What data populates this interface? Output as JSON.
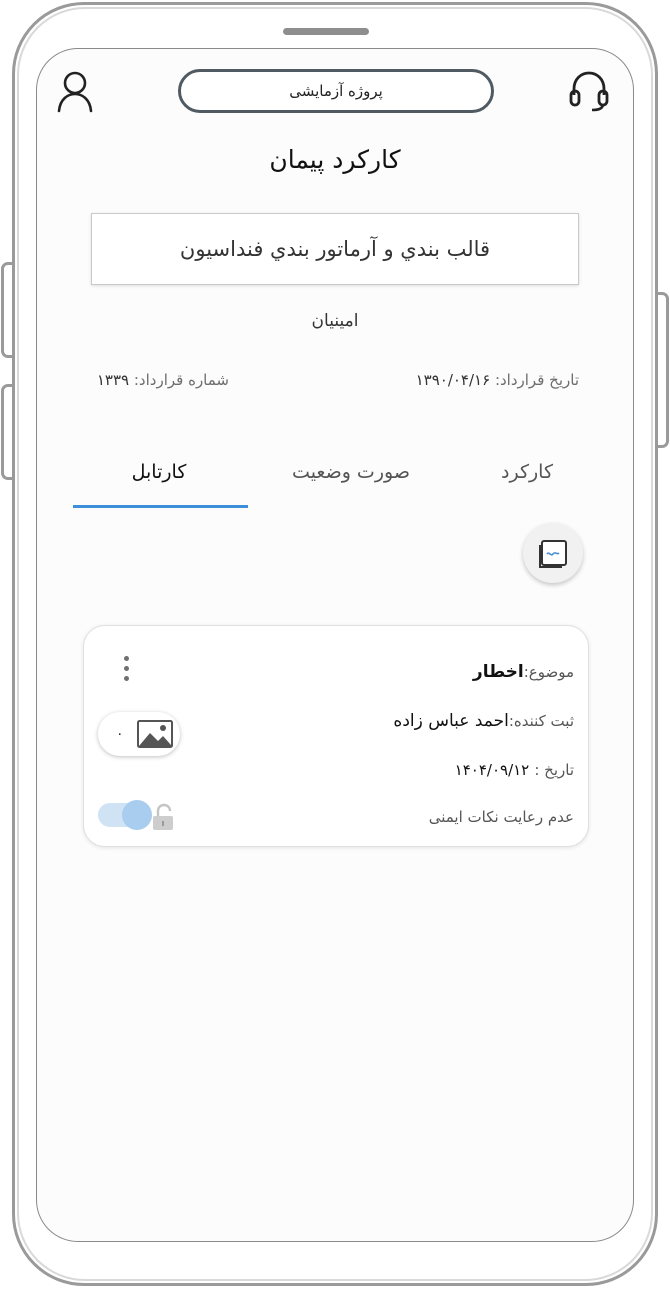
{
  "header": {
    "project_name": "پروژه آزمایشی",
    "profile_icon": "user-icon",
    "support_icon": "headset-icon"
  },
  "page_title": "کارکرد پیمان",
  "contract": {
    "title": "قالب بندي و آرماتور بندي فنداسيون",
    "contractor": "امینیان",
    "date_label": "تاریخ قرارداد:",
    "date_value": "۱۳۹۰/۰۴/۱۶",
    "number_label": "شماره قرارداد:",
    "number_value": "۱۳۳۹"
  },
  "tabs": [
    {
      "label": "کارکرد",
      "active": false
    },
    {
      "label": "صورت وضعیت",
      "active": false
    },
    {
      "label": "کارتابل",
      "active": true
    }
  ],
  "fab_icon": "new-document-icon",
  "cards": [
    {
      "subject_label": "موضوع:",
      "subject_value": "اخطار",
      "creator_label": "ثبت کننده:",
      "creator_value": "احمد عباس زاده",
      "date_label": "تاریخ :",
      "date_value": "۱۴۰۴/۰۹/۱۲",
      "description": "عدم رعایت نکات ایمنی",
      "image_count": "۰",
      "toggle_on": true
    }
  ],
  "colors": {
    "accent": "#3c8fd8",
    "toggle_track": "#cfe3f5",
    "toggle_knob": "#a9cdee",
    "frame": "#9a9a9a"
  }
}
